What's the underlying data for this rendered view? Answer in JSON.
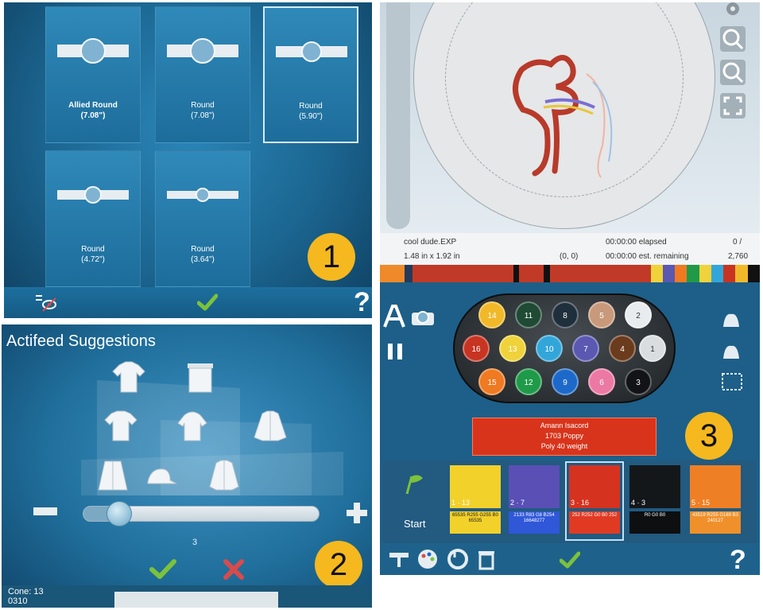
{
  "colors": {
    "accent": "#f5b81f",
    "check_green": "#7cc23b",
    "cancel_red": "#d94b4b",
    "panel_blue": "#1d6d9b"
  },
  "hoops": {
    "tiles": [
      {
        "name": "Allied Round",
        "size": "(7.08\")",
        "selected": false
      },
      {
        "name": "Round",
        "size": "(7.08\")",
        "selected": false
      },
      {
        "name": "Round",
        "size": "(5.90\")",
        "selected": true
      },
      {
        "name": "Round",
        "size": "(4.72\")",
        "selected": false
      },
      {
        "name": "Round",
        "size": "(3.64\")",
        "selected": false
      }
    ],
    "badge": "1",
    "icons": {
      "hide": "eye-slash-icon",
      "confirm": "check-icon",
      "help": "help-icon"
    }
  },
  "actifeed": {
    "title": "Actifeed Suggestions",
    "slider_value": "3",
    "slider_level": 0.16,
    "badge": "2",
    "cone_label": "Cone: 13",
    "cone_number": "0310",
    "icons": {
      "minus": "minus-icon",
      "plus": "plus-icon",
      "confirm": "check-icon",
      "cancel": "x-icon"
    }
  },
  "machine": {
    "design_name": "cool dude.EXP",
    "dimensions": "1.48 in x 1.92 in",
    "coords": "(0, 0)",
    "elapsed": "00:00:00 elapsed",
    "remaining": "00:00:00 est. remaining",
    "stitch_count": "0 /",
    "stitch_total": "2,760",
    "spools": [
      {
        "n": "14",
        "color": "#f1b92a"
      },
      {
        "n": "11",
        "color": "#1f4a34"
      },
      {
        "n": "8",
        "color": "#1f2f3b"
      },
      {
        "n": "5",
        "color": "#c89a7b"
      },
      {
        "n": "2",
        "color": "#e9ecee"
      },
      {
        "n": "16",
        "color": "#c83422"
      },
      {
        "n": "13",
        "color": "#f0d23b"
      },
      {
        "n": "10",
        "color": "#33a6d9"
      },
      {
        "n": "7",
        "color": "#5a58b0"
      },
      {
        "n": "4",
        "color": "#6b3b1d"
      },
      {
        "n": "1",
        "color": "#d9dde0"
      },
      {
        "n": "15",
        "color": "#ef7a22"
      },
      {
        "n": "12",
        "color": "#1f9a49"
      },
      {
        "n": "9",
        "color": "#1d69c9"
      },
      {
        "n": "6",
        "color": "#ec79a4"
      },
      {
        "n": "3",
        "color": "#111316"
      }
    ],
    "thread": {
      "brand": "Amann Isacord",
      "color": "1703 Poppy",
      "weight": "Poly 40 weight"
    },
    "start_label": "Start",
    "stops": [
      {
        "stop": "1",
        "spool": "13",
        "code": "65535 R255 G255 B0 65535",
        "swatch": "#f3d12b",
        "code_bg": "#f3d12b",
        "code_fg": "#1a1a1a"
      },
      {
        "stop": "2",
        "spool": "7",
        "code": "2133 R83 G8 B254 16648277",
        "swatch": "#5a4fb5",
        "code_bg": "#2f57d8",
        "code_fg": "#ffffff"
      },
      {
        "stop": "3",
        "spool": "16",
        "code": "252 R252 G0 B0 252",
        "swatch": "#d5321f",
        "code_bg": "#e13a23",
        "code_fg": "#ffffff",
        "current": true
      },
      {
        "stop": "4",
        "spool": "3",
        "code": "R0 G0 B0",
        "swatch": "#14171a",
        "code_bg": "#0d0f11",
        "code_fg": "#ffffff"
      },
      {
        "stop": "5",
        "spool": "15",
        "code": "43519 R255 G169 B3 240127",
        "swatch": "#ef7f24",
        "code_bg": "#f0902a",
        "code_fg": "#ffffff"
      }
    ],
    "badge": "3",
    "icons": {
      "text": "text-letter-icon",
      "move": "hoop-move-icon",
      "pause": "pause-icon",
      "zoom_in": "zoom-in-icon",
      "zoom_out": "zoom-out-icon",
      "fullscreen": "fullscreen-icon",
      "settings": "gear-icon",
      "flag": "flag-icon",
      "sew": "sewing-machine-icon",
      "palette": "palette-icon",
      "reset": "reset-icon",
      "trash": "trash-icon",
      "confirm": "check-icon",
      "help": "help-icon"
    }
  }
}
